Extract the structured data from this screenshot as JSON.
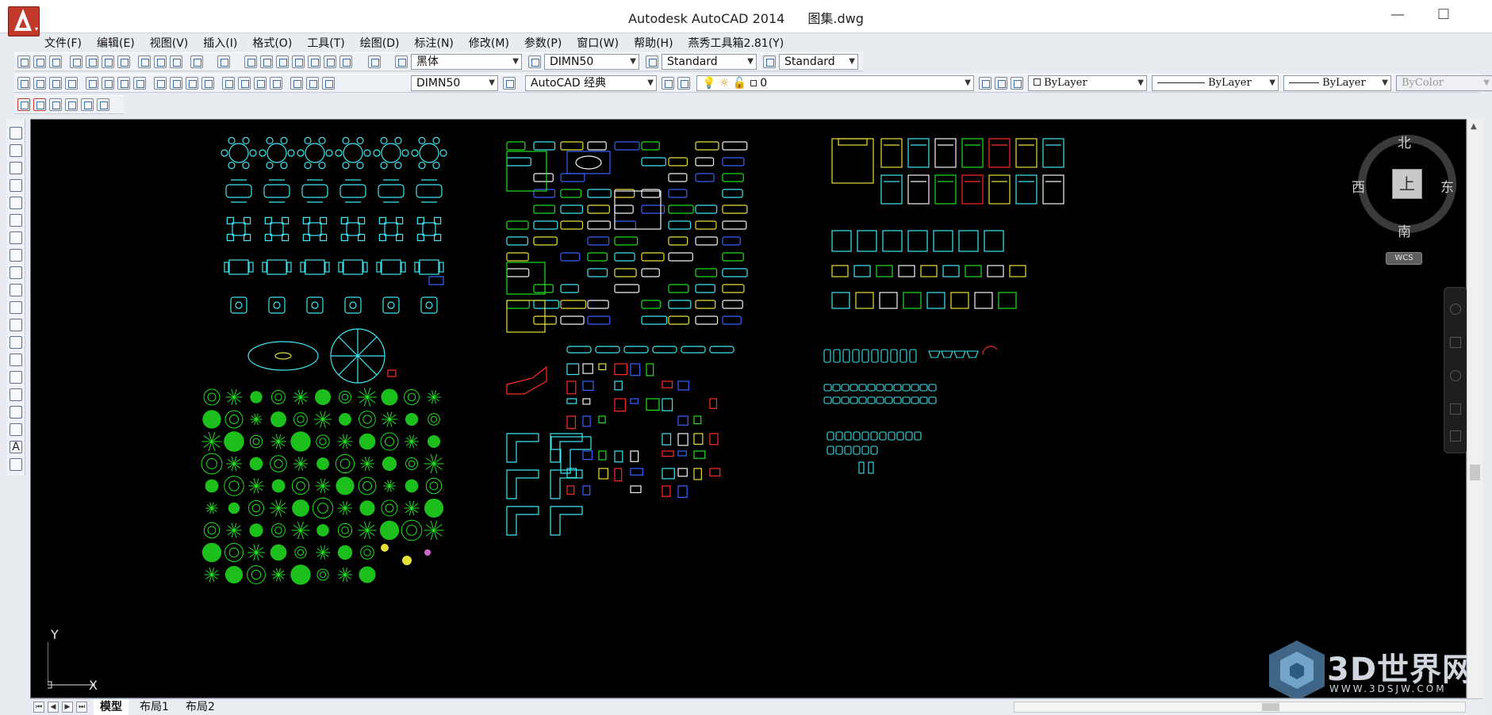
{
  "window": {
    "app_title": "Autodesk AutoCAD 2014",
    "file_name": "图集.dwg",
    "min": "—",
    "max": "☐",
    "close": "✕"
  },
  "menu": [
    "文件(F)",
    "编辑(E)",
    "视图(V)",
    "插入(I)",
    "格式(O)",
    "工具(T)",
    "绘图(D)",
    "标注(N)",
    "修改(M)",
    "参数(P)",
    "窗口(W)",
    "帮助(H)",
    "燕秀工具箱2.81(Y)"
  ],
  "toolbar1": {
    "text_font": "黑体",
    "dim_style": "DIMN50",
    "text_style": "Standard",
    "table_style": "Standard"
  },
  "toolbar2": {
    "dim_style": "DIMN50",
    "workspace": "AutoCAD 经典",
    "layer": "0",
    "color": "ByLayer",
    "linetype": "ByLayer",
    "lineweight": "ByLayer",
    "plotstyle": "ByColor"
  },
  "viewcube": {
    "north": "北",
    "south": "南",
    "east": "东",
    "west": "西",
    "top": "上",
    "wcs": "WCS"
  },
  "ucs": {
    "x": "X",
    "y": "Y"
  },
  "layout_tabs": [
    "模型",
    "布局1",
    "布局2"
  ],
  "watermark": {
    "text": "3D世界网",
    "url": "WWW.3DSJW.COM"
  },
  "colors": {
    "cyan": "#3fe6f0",
    "green": "#22e022",
    "yellow": "#e8e03a",
    "red": "#ff2a2a",
    "white": "#f2f2f2",
    "blue": "#3a60ff",
    "brand_red": "#c0392b"
  }
}
